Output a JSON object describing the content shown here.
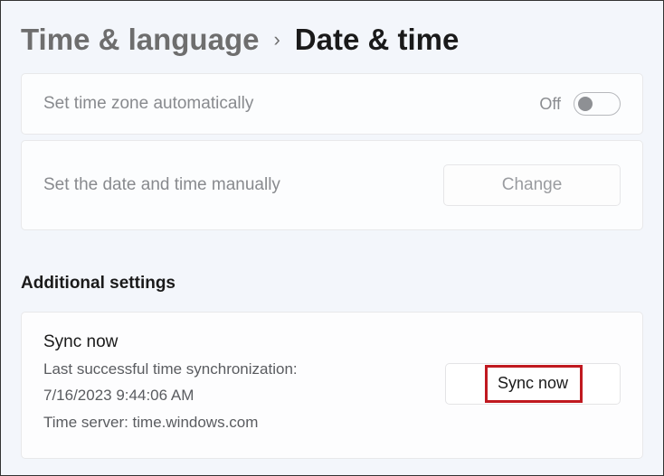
{
  "breadcrumb": {
    "parent": "Time & language",
    "current": "Date & time"
  },
  "timezone": {
    "label": "Set time zone automatically",
    "state": "Off"
  },
  "manual": {
    "label": "Set the date and time manually",
    "button": "Change"
  },
  "section_heading": "Additional settings",
  "sync": {
    "title": "Sync now",
    "last_label": "Last successful time synchronization:",
    "last_value": "7/16/2023 9:44:06 AM",
    "server_label": "Time server: time.windows.com",
    "button": "Sync now"
  }
}
